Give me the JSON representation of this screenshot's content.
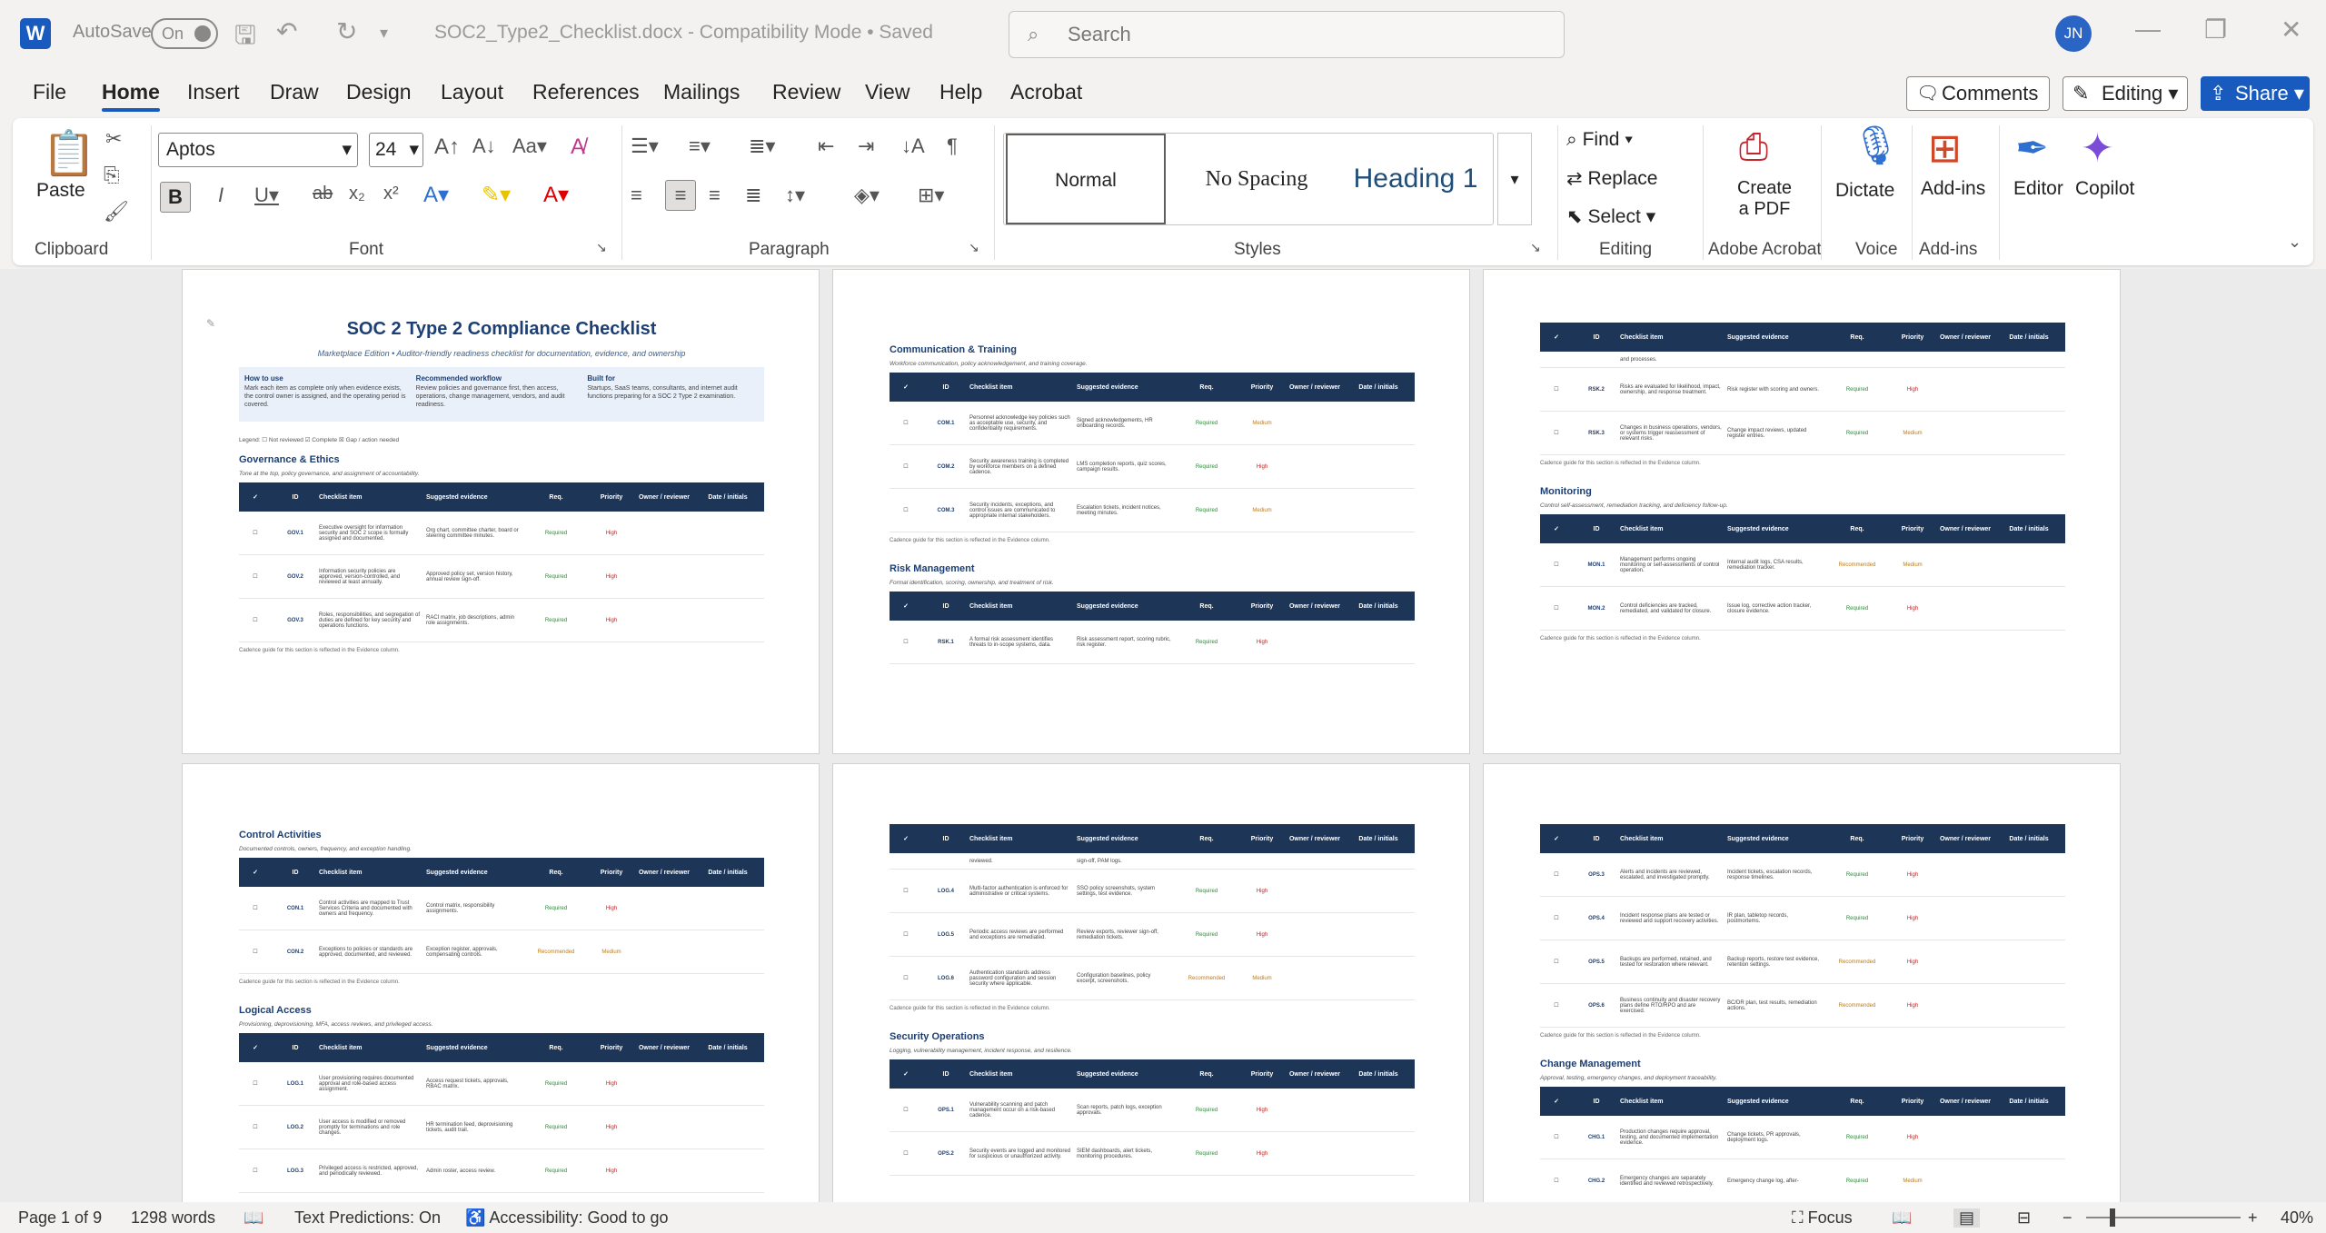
{
  "titlebar": {
    "app_icon": "W",
    "autosave": "AutoSave",
    "toggle": "On",
    "doc_title": "SOC2_Type2_Checklist.docx  -  Compatibility Mode  •  Saved",
    "search_placeholder": "Search",
    "avatar": "JN"
  },
  "menu": [
    "File",
    "Home",
    "Insert",
    "Draw",
    "Design",
    "Layout",
    "References",
    "Mailings",
    "Review",
    "View",
    "Help",
    "Acrobat"
  ],
  "actions": {
    "comments": "Comments",
    "editing": "Editing",
    "share": "Share"
  },
  "ribbon": {
    "clipboard": {
      "paste": "Paste",
      "label": "Clipboard"
    },
    "font": {
      "name": "Aptos",
      "size": "24",
      "label": "Font"
    },
    "paragraph": {
      "label": "Paragraph"
    },
    "styles": {
      "normal": "Normal",
      "no_spacing": "No Spacing",
      "heading1": "Heading 1",
      "label": "Styles"
    },
    "editing": {
      "find": "Find",
      "replace": "Replace",
      "select": "Select",
      "label": "Editing"
    },
    "acrobat": {
      "create": "Create",
      "create2": "a PDF",
      "label": "Adobe Acrobat"
    },
    "voice": {
      "dictate": "Dictate",
      "label": "Voice"
    },
    "addins": {
      "addins": "Add-ins",
      "label": "Add-ins"
    },
    "editor": "Editor",
    "copilot": "Copilot"
  },
  "doc": {
    "title": "SOC 2 Type 2 Compliance Checklist",
    "subtitle": "Marketplace Edition • Auditor-friendly readiness checklist for documentation, evidence, and ownership",
    "how_h": "How to use",
    "how_t": "Mark each item as complete only when evidence exists, the control owner is assigned, and the operating period is covered.",
    "work_h": "Recommended workflow",
    "work_t": "Review policies and governance first, then access, operations, change management, vendors, and audit readiness.",
    "built_h": "Built for",
    "built_t": "Startups, SaaS teams, consultants, and internet audit functions preparing for a SOC 2 Type 2 examination.",
    "legend": "Legend: ☐ Not reviewed  ☑ Complete  ☒ Gap / action needed",
    "cadence": "Cadence guide for this section is reflected in the Evidence column.",
    "headers": [
      "✓",
      "ID",
      "Checklist item",
      "Suggested evidence",
      "Req.",
      "Priority",
      "Owner / reviewer",
      "Date / initials"
    ],
    "sections": {
      "gov": {
        "h": "Governance & Ethics",
        "d": "Tone at the top, policy governance, and assignment of accountability.",
        "rows": [
          [
            "☐",
            "GOV.1",
            "Executive oversight for information security and SOC 2 scope is formally assigned and documented.",
            "Org chart, committee charter, board or steering committee minutes.",
            "Required",
            "High"
          ],
          [
            "☐",
            "GOV.2",
            "Information security policies are approved, version-controlled, and reviewed at least annually.",
            "Approved policy set, version history, annual review sign-off.",
            "Required",
            "High"
          ],
          [
            "☐",
            "GOV.3",
            "Roles, responsibilities, and segregation of duties are defined for key security and operations functions.",
            "RACI matrix, job descriptions, admin role assignments.",
            "Required",
            "High"
          ]
        ]
      },
      "comm": {
        "h": "Communication & Training",
        "d": "Workforce communication, policy acknowledgement, and training coverage.",
        "rows": [
          [
            "☐",
            "COM.1",
            "Personnel acknowledge key policies such as acceptable use, security, and confidentiality requirements.",
            "Signed acknowledgements, HR onboarding records.",
            "Required",
            "Medium"
          ],
          [
            "☐",
            "COM.2",
            "Security awareness training is completed by workforce members on a defined cadence.",
            "LMS completion reports, quiz scores, campaign results.",
            "Required",
            "High"
          ],
          [
            "☐",
            "COM.3",
            "Security incidents, exceptions, and control issues are communicated to appropriate internal stakeholders.",
            "Escalation tickets, incident notices, meeting minutes.",
            "Required",
            "Medium"
          ]
        ]
      },
      "risk": {
        "h": "Risk Management",
        "d": "Formal identification, scoring, ownership, and treatment of risk.",
        "rows": [
          [
            "☐",
            "RSK.1",
            "A formal risk assessment identifies threats to in-scope systems, data.",
            "Risk assessment report, scoring rubric, risk register.",
            "Required",
            "High"
          ]
        ]
      },
      "riskcont": {
        "rows": [
          [
            "",
            "",
            "and processes.",
            "",
            "",
            ""
          ],
          [
            "☐",
            "RSK.2",
            "Risks are evaluated for likelihood, impact, ownership, and response treatment.",
            "Risk register with scoring and owners.",
            "Required",
            "High"
          ],
          [
            "☐",
            "RSK.3",
            "Changes in business operations, vendors, or systems trigger reassessment of relevant risks.",
            "Change impact reviews, updated register entries.",
            "Required",
            "Medium"
          ]
        ]
      },
      "mon": {
        "h": "Monitoring",
        "d": "Control self-assessment, remediation tracking, and deficiency follow-up.",
        "rows": [
          [
            "☐",
            "MON.1",
            "Management performs ongoing monitoring or self-assessments of control operation.",
            "Internal audit logs, CSA results, remediation tracker.",
            "Recommended",
            "Medium"
          ],
          [
            "☐",
            "MON.2",
            "Control deficiencies are tracked, remediated, and validated for closure.",
            "Issue log, corrective action tracker, closure evidence.",
            "Required",
            "High"
          ]
        ]
      },
      "ctrl": {
        "h": "Control Activities",
        "d": "Documented controls, owners, frequency, and exception handling.",
        "rows": [
          [
            "☐",
            "CON.1",
            "Control activities are mapped to Trust Services Criteria and documented with owners and frequency.",
            "Control matrix, responsibility assignments.",
            "Required",
            "High"
          ],
          [
            "☐",
            "CON.2",
            "Exceptions to policies or standards are approved, documented, and reviewed.",
            "Exception register, approvals, compensating controls.",
            "Recommended",
            "Medium"
          ]
        ]
      },
      "la": {
        "h": "Logical Access",
        "d": "Provisioning, deprovisioning, MFA, access reviews, and privileged access.",
        "rows": [
          [
            "☐",
            "LOG.1",
            "User provisioning requires documented approval and role-based access assignment.",
            "Access request tickets, approvals, RBAC matrix.",
            "Required",
            "High"
          ],
          [
            "☐",
            "LOG.2",
            "User access is modified or removed promptly for terminations and role changes.",
            "HR termination feed, deprovisioning tickets, audit trail.",
            "Required",
            "High"
          ],
          [
            "☐",
            "LOG.3",
            "Privileged access is restricted, approved, and periodically reviewed.",
            "Admin roster, access review.",
            "Required",
            "High"
          ]
        ]
      },
      "lacont": {
        "rows": [
          [
            "",
            "",
            "reviewed.",
            "sign-off, PAM logs.",
            "",
            ""
          ],
          [
            "☐",
            "LOG.4",
            "Multi-factor authentication is enforced for administrative or critical systems.",
            "SSO policy screenshots, system settings, test evidence.",
            "Required",
            "High"
          ],
          [
            "☐",
            "LOG.5",
            "Periodic access reviews are performed and exceptions are remediated.",
            "Review exports, reviewer sign-off, remediation tickets.",
            "Required",
            "High"
          ],
          [
            "☐",
            "LOG.6",
            "Authentication standards address password configuration and session security where applicable.",
            "Configuration baselines, policy excerpt, screenshots.",
            "Recommended",
            "Medium"
          ]
        ]
      },
      "secops": {
        "h": "Security Operations",
        "d": "Logging, vulnerability management, incident response, and resilience.",
        "rows": [
          [
            "☐",
            "OPS.1",
            "Vulnerability scanning and patch management occur on a risk-based cadence.",
            "Scan reports, patch logs, exception approvals.",
            "Required",
            "High"
          ],
          [
            "☐",
            "OPS.2",
            "Security events are logged and monitored for suspicious or unauthorized activity.",
            "SIEM dashboards, alert tickets, monitoring procedures.",
            "Required",
            "High"
          ]
        ]
      },
      "opscont": {
        "rows": [
          [
            "☐",
            "OPS.3",
            "Alerts and incidents are reviewed, escalated, and investigated promptly.",
            "Incident tickets, escalation records, response timelines.",
            "Required",
            "High"
          ],
          [
            "☐",
            "OPS.4",
            "Incident response plans are tested or reviewed and support recovery activities.",
            "IR plan, tabletop records, postmortems.",
            "Required",
            "High"
          ],
          [
            "☐",
            "OPS.5",
            "Backups are performed, retained, and tested for restoration where relevant.",
            "Backup reports, restore test evidence, retention settings.",
            "Recommended",
            "High"
          ],
          [
            "☐",
            "OPS.6",
            "Business continuity and disaster recovery plans define RTO/RPO and are exercised.",
            "BC/DR plan, test results, remediation actions.",
            "Recommended",
            "High"
          ]
        ]
      },
      "chg": {
        "h": "Change Management",
        "d": "Approval, testing, emergency changes, and deployment traceability.",
        "rows": [
          [
            "☐",
            "CHG.1",
            "Production changes require approval, testing, and documented implementation evidence.",
            "Change tickets, PR approvals, deployment logs.",
            "Required",
            "High"
          ],
          [
            "☐",
            "CHG.2",
            "Emergency changes are separately identified and reviewed retrospectively.",
            "Emergency change log, after-",
            "Required",
            "Medium"
          ]
        ]
      }
    }
  },
  "status": {
    "page": "Page 1 of 9",
    "words": "1298 words",
    "predictions": "Text Predictions: On",
    "accessibility": "Accessibility: Good to go",
    "focus": "Focus",
    "zoom": "40%"
  }
}
